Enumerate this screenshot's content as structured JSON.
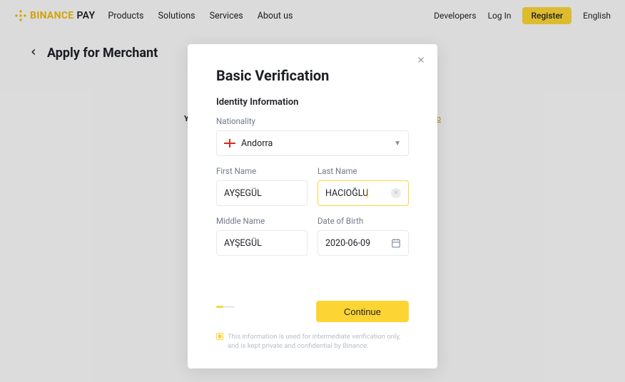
{
  "header": {
    "brand_main": "BINANCE",
    "brand_sub": "PAY",
    "nav": [
      "Products",
      "Solutions",
      "Services",
      "About us"
    ],
    "developers": "Developers",
    "login": "Log In",
    "register": "Register",
    "language": "English"
  },
  "page": {
    "title": "Apply for Merchant",
    "bg_hint": "Y",
    "bg_link": "o"
  },
  "modal": {
    "title": "Basic Verification",
    "section": "Identity Information",
    "nationality_label": "Nationality",
    "nationality_value": "Andorra",
    "first_name_label": "First Name",
    "first_name_value": "AYŞEGÜL",
    "last_name_label": "Last Name",
    "last_name_value": "HACIOĞLU",
    "middle_name_label": "Middle Name",
    "middle_name_value": "AYŞEGÜL",
    "dob_label": "Date of Birth",
    "dob_value": "2020-06-09",
    "continue": "Continue",
    "note": "This information is used for intermediate verification only, and is kept private and confidential by Binance."
  }
}
